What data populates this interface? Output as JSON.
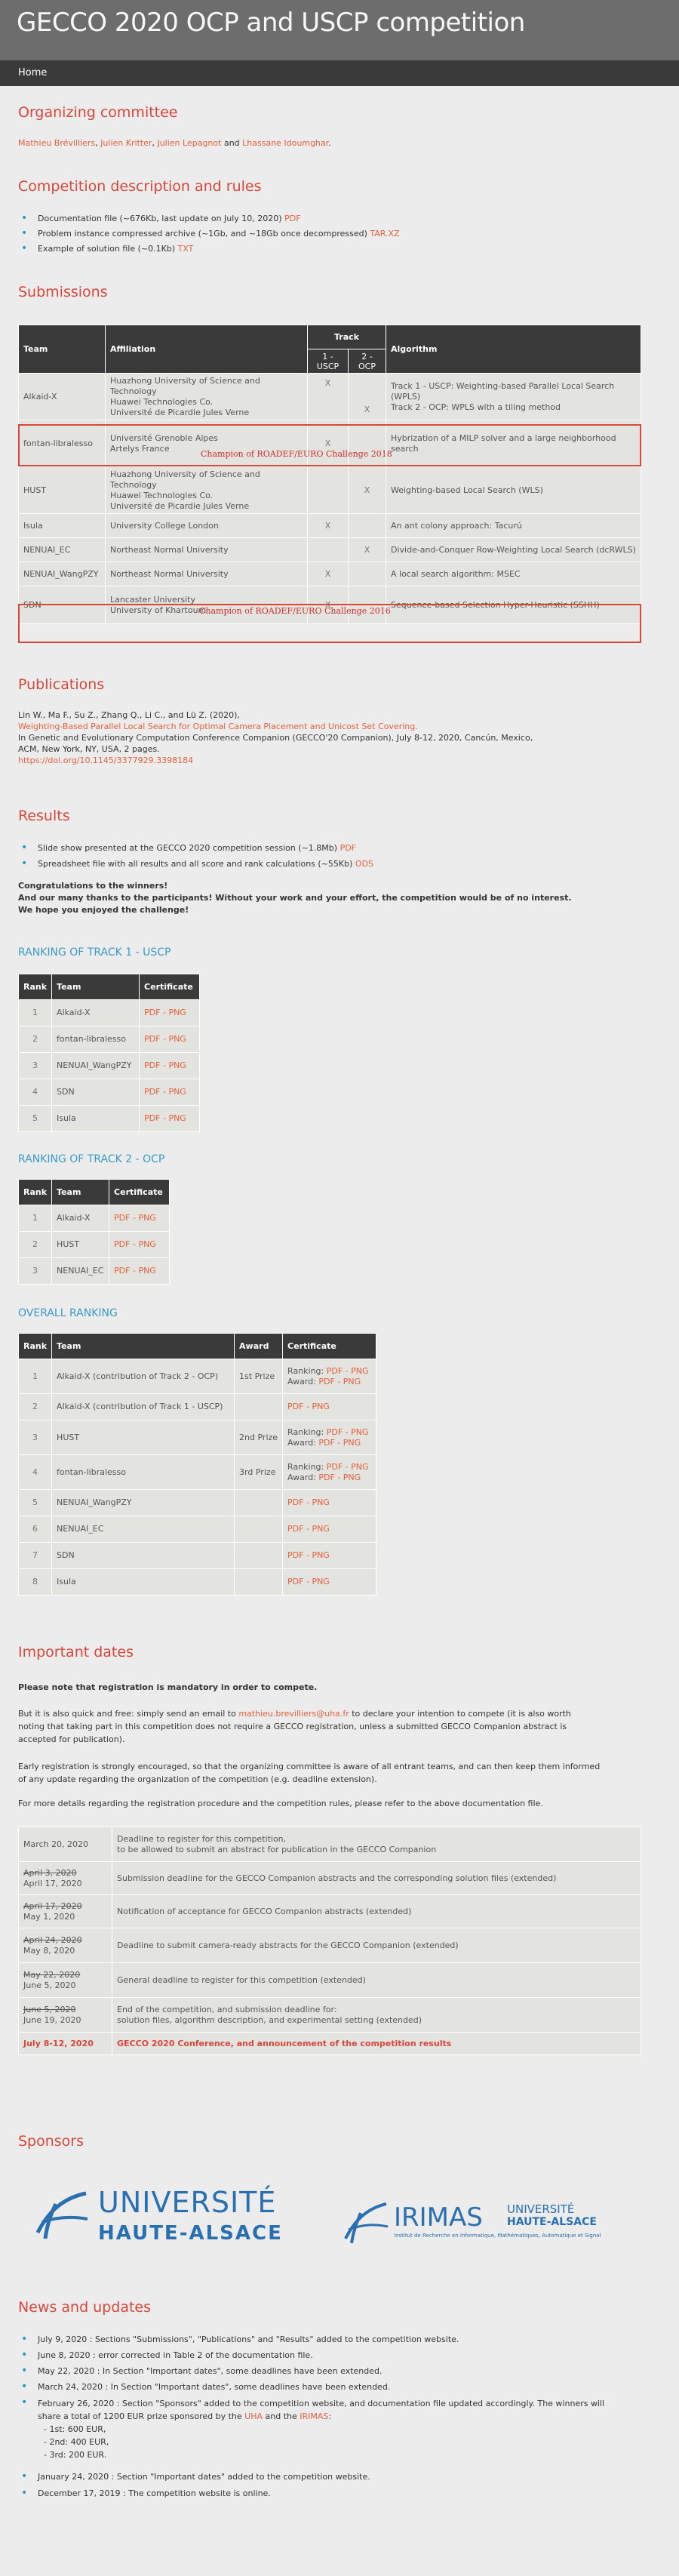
{
  "site_title": "GECCO 2020 OCP and USCP competition",
  "nav": {
    "home": "Home"
  },
  "committee": {
    "heading": "Organizing committee",
    "members": [
      "Mathieu Brévilliers",
      "Julien Kritter",
      "Julien Lepagnot",
      "Lhassane Idoumghar"
    ],
    "sep": ", ",
    "and": " and ",
    "end": "."
  },
  "rules": {
    "heading": "Competition description and rules",
    "doc_text": "Documentation file (~676Kb, last update on July 10, 2020)",
    "doc_link": "PDF",
    "instances_text": "Problem instance compressed archive (~1Gb, and ~18Gb once decompressed)",
    "instances_link": "TAR.XZ",
    "example_text": "Example of solution file (~0.1Kb)",
    "example_link": "TXT"
  },
  "submissions": {
    "heading": "Submissions",
    "headers": {
      "team": "Team",
      "affiliation": "Affiliation",
      "track": "Track",
      "track1": "1 - USCP",
      "track2": "2 - OCP",
      "algorithm": "Algorithm"
    },
    "rows": [
      {
        "team": "Alkaid-X",
        "affiliation": [
          "Huazhong University of Science and Technology",
          "Huawei Technologies Co.",
          "Université de Picardie Jules Verne"
        ],
        "t1": "X",
        "t2": "X",
        "algorithm": [
          "Track 1 - USCP: Weighting-based Parallel Local Search (WPLS)",
          "Track 2 - OCP: WPLS with a tiling method"
        ]
      },
      {
        "team": "fontan-libralesso",
        "affiliation": [
          "Université Grenoble Alpes",
          "Artelys France"
        ],
        "t1": "X",
        "t2": "",
        "algorithm": [
          "Hybrization of a MILP solver and a large neighborhood search"
        ]
      },
      {
        "team": "HUST",
        "affiliation": [
          "Huazhong University of Science and Technology",
          "Huawei Technologies Co.",
          "Université de Picardie Jules Verne"
        ],
        "t1": "",
        "t2": "X",
        "algorithm": [
          "Weighting-based Local Search (WLS)"
        ]
      },
      {
        "team": "Isula",
        "affiliation": [
          "University College London"
        ],
        "t1": "X",
        "t2": "",
        "algorithm": [
          "An ant colony approach: Tacurú"
        ]
      },
      {
        "team": "NENUAI_EC",
        "affiliation": [
          "Northeast Normal University"
        ],
        "t1": "",
        "t2": "X",
        "algorithm": [
          "Divide-and-Conquer Row-Weighting Local Search (dcRWLS)"
        ]
      },
      {
        "team": "NENUAI_WangPZY",
        "affiliation": [
          "Northeast Normal University"
        ],
        "t1": "X",
        "t2": "",
        "algorithm": [
          "A local search algorithm: MSEC"
        ]
      },
      {
        "team": "SDN",
        "affiliation": [
          "Lancaster University",
          "University of Khartoum"
        ],
        "t1": "X",
        "t2": "",
        "algorithm": [
          "Sequence-based Selection Hyper-Heuristic (SSHH)"
        ]
      }
    ],
    "champ_2018": "Champion of ROADEF/EURO Challenge 2018",
    "champ_2016": "Champion of ROADEF/EURO Challenge 2016"
  },
  "publications": {
    "heading": "Publications",
    "authors": "Lin W., Ma F., Su Z., Zhang Q., Li C., and Lü Z. (2020),",
    "title": "Weighting-Based Parallel Local Search for Optimal Camera Placement and Unicost Set Covering.",
    "venue": "In Genetic and Evolutionary Computation Conference Companion (GECCO'20 Companion), July 8-12, 2020, Cancún, Mexico,",
    "pub": "ACM, New York, NY, USA, 2 pages.",
    "doi": "https://doi.org/10.1145/3377929.3398184"
  },
  "results": {
    "heading": "Results",
    "slides_text": "Slide show presented at the GECCO 2020 competition session (~1.8Mb)",
    "slides_link": "PDF",
    "sheet_text": "Spreadsheet file with all results and all score and rank calculations (~55Kb)",
    "sheet_link": "ODS",
    "congrats": [
      "Congratulations to the winners!",
      "And our many thanks to the participants! Without your work and your effort, the competition would be of no interest.",
      "We hope you enjoyed the challenge!"
    ],
    "track1_heading": "RANKING OF TRACK 1 - USCP",
    "track2_heading": "RANKING OF TRACK 2 - OCP",
    "overall_heading": "OVERALL RANKING",
    "headers": {
      "rank": "Rank",
      "team": "Team",
      "certificate": "Certificate",
      "award": "Award"
    },
    "cert": "PDF - PNG",
    "ranking_label": "Ranking: ",
    "award_label": "Award: ",
    "track1": [
      {
        "rank": "1",
        "team": "Alkaid-X"
      },
      {
        "rank": "2",
        "team": "fontan-libralesso"
      },
      {
        "rank": "3",
        "team": "NENUAI_WangPZY"
      },
      {
        "rank": "4",
        "team": "SDN"
      },
      {
        "rank": "5",
        "team": "Isula"
      }
    ],
    "track2": [
      {
        "rank": "1",
        "team": "Alkaid-X"
      },
      {
        "rank": "2",
        "team": "HUST"
      },
      {
        "rank": "3",
        "team": "NENUAI_EC"
      }
    ],
    "overall": [
      {
        "rank": "1",
        "team": "Alkaid-X (contribution of Track 2 - OCP)",
        "award": "1st Prize",
        "double": true
      },
      {
        "rank": "2",
        "team": "Alkaid-X (contribution of Track 1 - USCP)",
        "award": "",
        "double": false
      },
      {
        "rank": "3",
        "team": "HUST",
        "award": "2nd Prize",
        "double": true
      },
      {
        "rank": "4",
        "team": "fontan-libralesso",
        "award": "3rd Prize",
        "double": true
      },
      {
        "rank": "5",
        "team": "NENUAI_WangPZY",
        "award": "",
        "double": false
      },
      {
        "rank": "6",
        "team": "NENUAI_EC",
        "award": "",
        "double": false
      },
      {
        "rank": "7",
        "team": "SDN",
        "award": "",
        "double": false
      },
      {
        "rank": "8",
        "team": "Isula",
        "award": "",
        "double": false
      }
    ]
  },
  "dates": {
    "heading": "Important dates",
    "mandatory": "Please note that registration is mandatory in order to compete.",
    "p1_before": "But it is also quick and free: simply send an email to ",
    "email": "mathieu.brevilliers@uha.fr",
    "p1_after": " to declare your intention to compete (it is also worth",
    "p1_line2": "noting that taking part in this competition does not require a GECCO registration, unless a submitted GECCO Companion abstract is",
    "p1_line3": "accepted for publication).",
    "p2_line1": "Early registration is strongly encouraged, so that the organizing committee is aware of all entrant teams, and can then keep them informed",
    "p2_line2": "of any update regarding the organization of the competition (e.g. deadline extension).",
    "p3": "For more details regarding the registration procedure and the competition rules, please refer to the above documentation file.",
    "rows": [
      {
        "old": "",
        "new": "March 20, 2020",
        "desc": [
          "Deadline to register for this competition,",
          "to be allowed to submit an abstract for publication in the GECCO Companion"
        ]
      },
      {
        "old": "April 3, 2020",
        "new": "April 17, 2020",
        "desc": [
          "Submission deadline for the GECCO Companion abstracts and the corresponding solution files (extended)"
        ]
      },
      {
        "old": "April 17, 2020",
        "new": "May 1, 2020",
        "desc": [
          "Notification of acceptance for GECCO Companion abstracts (extended)"
        ]
      },
      {
        "old": "April 24, 2020",
        "new": "May 8, 2020",
        "desc": [
          "Deadline to submit camera-ready abstracts for the GECCO Companion (extended)"
        ]
      },
      {
        "old": "May 22, 2020",
        "new": "June 5, 2020",
        "desc": [
          "General deadline to register for this competition (extended)"
        ]
      },
      {
        "old": "June 5, 2020",
        "new": "June 19, 2020",
        "desc": [
          "End of the competition, and submission deadline for:",
          "solution files, algorithm description, and experimental setting (extended)"
        ]
      }
    ],
    "final": {
      "date": "July 8-12, 2020",
      "desc": "GECCO 2020 Conference, and announcement of the competition results"
    }
  },
  "sponsors": {
    "heading": "Sponsors",
    "uha_line1": "UNIVERSITÉ",
    "uha_line2": "HAUTE-ALSACE",
    "irimas": "IRIMAS",
    "irimas_u1": "UNIVERSITÉ",
    "irimas_u2": "HAUTE-ALSACE",
    "irimas_sub": "Institut de Recherche en Informatique, Mathématiques, Automatique et Signal"
  },
  "news": {
    "heading": "News and updates",
    "items": [
      "July 9, 2020 : Sections \"Submissions\", \"Publications\" and \"Results\" added to the competition website.",
      "June 8, 2020 : error corrected in Table 2 of the documentation file.",
      "May 22, 2020 : In Section \"Important dates\", some deadlines have been extended.",
      "March 24, 2020 : In Section \"Important dates\", some deadlines have been extended."
    ],
    "feb_line1": "February 26, 2020 : Section \"Sponsors\" added to the competition website, and documentation file updated accordingly. The winners will",
    "feb_line2_a": "share a total of 1200 EUR prize sponsored by the ",
    "feb_uha": "UHA",
    "feb_and": " and the ",
    "feb_irimas": "IRIMAS",
    "feb_colon": ":",
    "prizes": [
      "- 1st: 600 EUR,",
      "- 2nd: 400 EUR,",
      "- 3rd: 200 EUR."
    ],
    "last": [
      "January 24, 2020 : Section \"Important dates\" added to the competition website.",
      "December 17, 2019 : The competition website is online."
    ]
  },
  "colors": {
    "accent": "#d9463a",
    "link": "#e8603c",
    "subhead": "#3a9ac7",
    "header": "#6d6d6d",
    "nav": "#3a3a3a"
  }
}
